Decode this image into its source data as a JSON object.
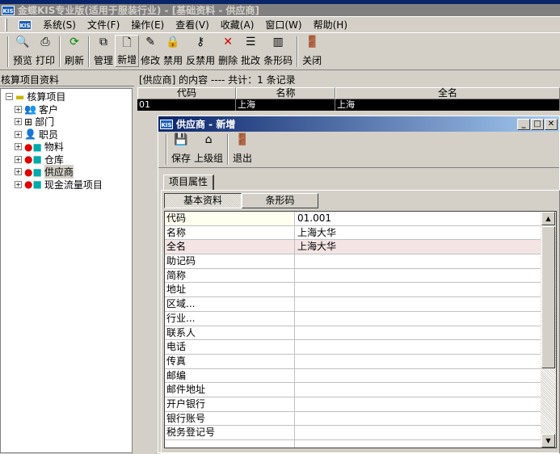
{
  "app": {
    "title": "金蝶KIS专业版(适用于服装行业) - [基础资料 - 供应商]",
    "logo": "KIS"
  },
  "menu": [
    "系统(S)",
    "文件(F)",
    "操作(E)",
    "查看(V)",
    "收藏(A)",
    "窗口(W)",
    "帮助(H)"
  ],
  "toolbar": [
    {
      "label": "预览",
      "icon": "preview-icon"
    },
    {
      "label": "打印",
      "icon": "printer-icon"
    },
    {
      "label": "刷新",
      "icon": "refresh-icon"
    },
    {
      "label": "管理",
      "icon": "manage-icon"
    },
    {
      "label": "新增",
      "icon": "new-doc-icon"
    },
    {
      "label": "修改",
      "icon": "edit-icon"
    },
    {
      "label": "禁用",
      "icon": "lock-icon"
    },
    {
      "label": "反禁用",
      "icon": "key-icon"
    },
    {
      "label": "删除",
      "icon": "delete-icon"
    },
    {
      "label": "批改",
      "icon": "batch-edit-icon"
    },
    {
      "label": "条形码",
      "icon": "barcode-icon"
    },
    {
      "label": "关闭",
      "icon": "exit-door-icon"
    }
  ],
  "left": {
    "header": "核算项目资料",
    "root": "核算项目",
    "items": [
      "客户",
      "部门",
      "职员",
      "物料",
      "仓库",
      "供应商",
      "现金流量项目"
    ],
    "selected": "供应商"
  },
  "list": {
    "header": "[供应商] 的内容 ---- 共计：1 条记录",
    "columns": [
      "代码",
      "名称",
      "全名"
    ],
    "rows": [
      [
        "01",
        "上海",
        "上海"
      ]
    ]
  },
  "dialog": {
    "title": "供应商 - 新增",
    "toolbar": [
      "保存",
      "上级组",
      "退出"
    ],
    "tab": "项目属性",
    "subtabs": [
      "基本资料",
      "条形码"
    ],
    "fields": [
      {
        "label": "代码",
        "value": "01.001"
      },
      {
        "label": "名称",
        "value": "上海大华"
      },
      {
        "label": "全名",
        "value": "上海大华"
      },
      {
        "label": "助记码",
        "value": ""
      },
      {
        "label": "简称",
        "value": ""
      },
      {
        "label": "地址",
        "value": ""
      },
      {
        "label": "区域...",
        "value": ""
      },
      {
        "label": "行业...",
        "value": ""
      },
      {
        "label": "联系人",
        "value": ""
      },
      {
        "label": "电话",
        "value": ""
      },
      {
        "label": "传真",
        "value": ""
      },
      {
        "label": "邮编",
        "value": ""
      },
      {
        "label": "邮件地址",
        "value": ""
      },
      {
        "label": "开户银行",
        "value": ""
      },
      {
        "label": "银行账号",
        "value": ""
      },
      {
        "label": "税务登记号",
        "value": ""
      }
    ]
  }
}
